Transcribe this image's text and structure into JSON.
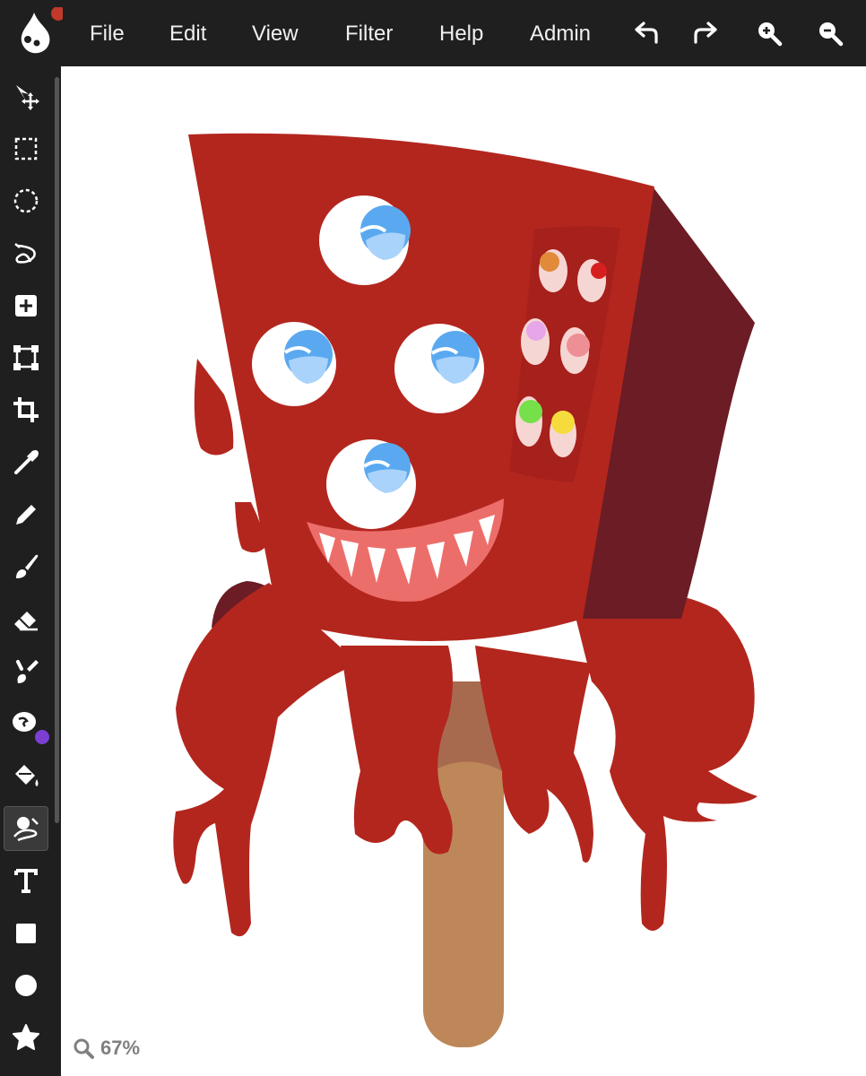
{
  "app": {
    "logo_icon": "paint-drop-logo-icon",
    "notification_color": "#c0392b"
  },
  "menu": {
    "items": [
      "File",
      "Edit",
      "View",
      "Filter",
      "Help",
      "Admin"
    ]
  },
  "toolbar": {
    "icons": [
      "undo-icon",
      "redo-icon",
      "zoom-in-icon",
      "zoom-out-icon"
    ]
  },
  "tools": [
    "move-tool-icon",
    "rect-select-icon",
    "ellipse-select-icon",
    "lasso-icon",
    "add-layer-icon",
    "transform-icon",
    "crop-icon",
    "eyedropper-icon",
    "pencil-icon",
    "brush-icon",
    "eraser-icon",
    "smudge-icon",
    "clone-stamp-icon",
    "fill-bucket-icon",
    "blend-tool-icon",
    "text-icon",
    "rectangle-shape-icon",
    "ellipse-shape-icon",
    "star-shape-icon"
  ],
  "active_tool": "blend-tool-icon",
  "accent_color": "#7b3fd4",
  "status": {
    "zoom_label": "67%"
  },
  "colors": {
    "ui_bg": "#1f1f1f",
    "canvas_bg": "#ffffff",
    "creature_red": "#b3261e",
    "creature_dark": "#6b1c24",
    "stick": "#bd8759"
  }
}
